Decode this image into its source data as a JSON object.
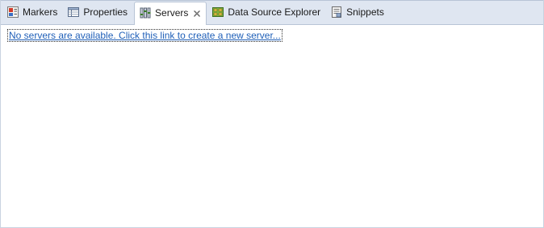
{
  "tabs": [
    {
      "label": "Markers",
      "icon": "markers-icon"
    },
    {
      "label": "Properties",
      "icon": "properties-icon"
    },
    {
      "label": "Servers",
      "icon": "servers-icon",
      "active": true,
      "closable": true
    },
    {
      "label": "Data Source Explorer",
      "icon": "data-source-explorer-icon"
    },
    {
      "label": "Snippets",
      "icon": "snippets-icon"
    }
  ],
  "servers_view": {
    "empty_link": "No servers are available. Click this link to create a new server..."
  },
  "colors": {
    "tabbar_bg": "#dfe6f1",
    "link": "#1f5fb8",
    "border": "#b8c4d6"
  }
}
